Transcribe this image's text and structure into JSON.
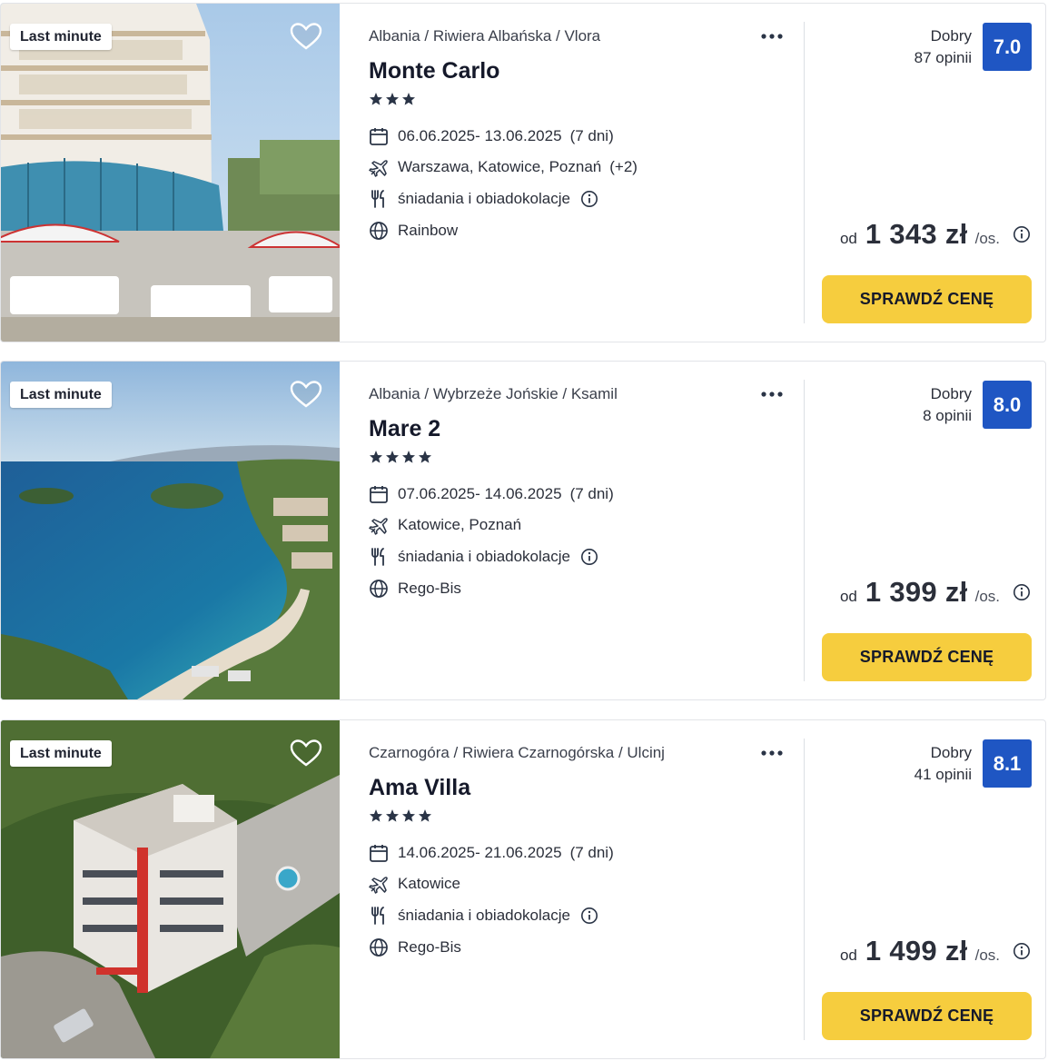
{
  "offers": [
    {
      "badge": "Last minute",
      "location": "Albania / Riwiera Albańska / Vlora",
      "name": "Monte Carlo",
      "stars": 3,
      "dates": "06.06.2025- 13.06.2025",
      "duration": "(7 dni)",
      "departures": "Warszawa, Katowice, Poznań",
      "departures_extra": "(+2)",
      "board": "śniadania i obiadokolacje",
      "operator": "Rainbow",
      "rating_label": "Dobry",
      "reviews": "87 opinii",
      "score": "7.0",
      "price_prefix": "od",
      "price": "1 343 zł",
      "price_suffix": "/os.",
      "cta": "SPRAWDŹ CENĘ"
    },
    {
      "badge": "Last minute",
      "location": "Albania / Wybrzeże Jońskie / Ksamil",
      "name": "Mare 2",
      "stars": 4,
      "dates": "07.06.2025- 14.06.2025",
      "duration": "(7 dni)",
      "departures": "Katowice, Poznań",
      "departures_extra": "",
      "board": "śniadania i obiadokolacje",
      "operator": "Rego-Bis",
      "rating_label": "Dobry",
      "reviews": "8 opinii",
      "score": "8.0",
      "price_prefix": "od",
      "price": "1 399 zł",
      "price_suffix": "/os.",
      "cta": "SPRAWDŹ CENĘ"
    },
    {
      "badge": "Last minute",
      "location": "Czarnogóra / Riwiera Czarnogórska / Ulcinj",
      "name": "Ama Villa",
      "stars": 4,
      "dates": "14.06.2025- 21.06.2025",
      "duration": "(7 dni)",
      "departures": "Katowice",
      "departures_extra": "",
      "board": "śniadania i obiadokolacje",
      "operator": "Rego-Bis",
      "rating_label": "Dobry",
      "reviews": "41 opinii",
      "score": "8.1",
      "price_prefix": "od",
      "price": "1 499 zł",
      "price_suffix": "/os.",
      "cta": "SPRAWDŹ CENĘ"
    }
  ],
  "colors": {
    "score_bg": "#1f56c3",
    "cta_bg": "#f6cd3e",
    "star": "#2a3446"
  },
  "icons": [
    "heart-icon",
    "more-dots-icon",
    "star-icon",
    "calendar-icon",
    "plane-icon",
    "cutlery-icon",
    "globe-icon",
    "info-icon"
  ]
}
